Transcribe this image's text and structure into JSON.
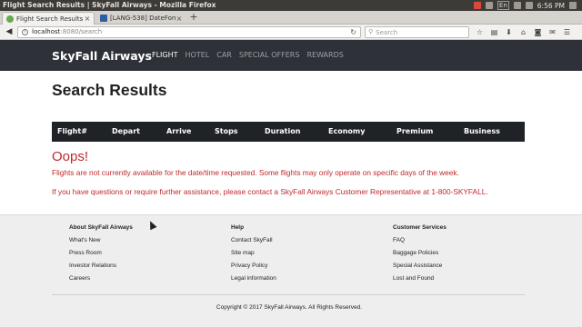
{
  "os": {
    "window_title": "Flight Search Results | SkyFall Airways - Mozilla Firefox",
    "keyboard_layout": "En",
    "time": "6:56 PM"
  },
  "browser": {
    "tabs": [
      {
        "label": "Flight Search Results",
        "favicon": "globe-icon",
        "close": "×"
      },
      {
        "label": "[LANG-538] DateFormat",
        "favicon": "jira-icon",
        "close": "×"
      }
    ],
    "new_tab": "+",
    "url_host": "localhost",
    "url_path": ":8080/search",
    "search_placeholder": "Search"
  },
  "site": {
    "brand": "SkyFall Airways",
    "nav": [
      {
        "label": "FLIGHT",
        "active": true
      },
      {
        "label": "HOTEL",
        "active": false
      },
      {
        "label": "CAR",
        "active": false
      },
      {
        "label": "SPECIAL OFFERS",
        "active": false
      },
      {
        "label": "REWARDS",
        "active": false
      }
    ]
  },
  "main": {
    "title": "Search Results",
    "table_headers": [
      "Flight#",
      "Depart",
      "Arrive",
      "Stops",
      "Duration",
      "Economy",
      "Premium",
      "Business"
    ],
    "error_heading": "Oops!",
    "error_line1": "Flights are not currently available for the date/time requested. Some flights may only operate on specific days of the week.",
    "error_line2": "If you have questions or require further assistance, please contact a SkyFall Airways Customer Representative at 1-800-SKYFALL."
  },
  "footer": {
    "columns": [
      {
        "heading": "About SkyFall Airways",
        "links": [
          "What's New",
          "Press Room",
          "Investor Relations",
          "Careers"
        ]
      },
      {
        "heading": "Help",
        "links": [
          "Contact SkyFall",
          "Site map",
          "Privacy Policy",
          "Legal information"
        ]
      },
      {
        "heading": "Customer Services",
        "links": [
          "FAQ",
          "Baggage Policies",
          "Special Assistance",
          "Lost and Found"
        ]
      }
    ],
    "copyright": "Copyright © 2017 SkyFall Airways. All Rights Reserved."
  },
  "colors": {
    "header_bg": "#2e3238",
    "error_red": "#c0282d",
    "footer_bg": "#eeeeee"
  }
}
